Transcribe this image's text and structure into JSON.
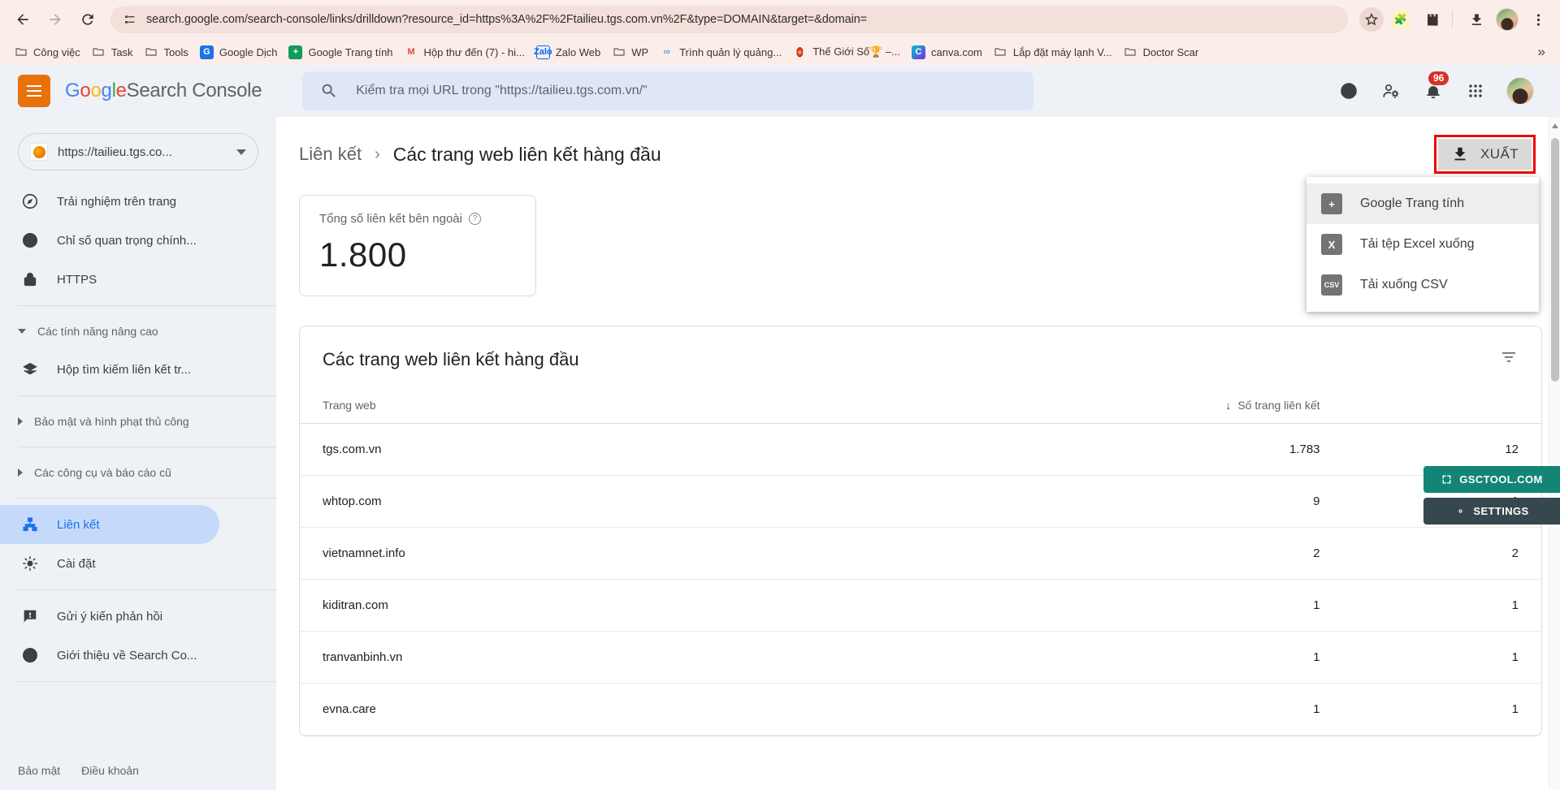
{
  "browser": {
    "url": "search.google.com/search-console/links/drilldown?resource_id=https%3A%2F%2Ftailieu.tgs.com.vn%2F&type=DOMAIN&target=&domain=",
    "back_icon": "back-arrow-icon",
    "forward_icon": "forward-arrow-icon",
    "reload_icon": "reload-icon",
    "bookmarks": [
      {
        "label": "Công việc",
        "icon": "folder-icon"
      },
      {
        "label": "Task",
        "icon": "folder-icon"
      },
      {
        "label": "Tools",
        "icon": "folder-icon"
      },
      {
        "label": "Google Dịch",
        "icon": "google-translate-icon"
      },
      {
        "label": "Google Trang tính",
        "icon": "google-sheets-icon"
      },
      {
        "label": "Hộp thư đến (7) - hi...",
        "icon": "gmail-icon"
      },
      {
        "label": "Zalo Web",
        "icon": "zalo-icon"
      },
      {
        "label": "WP",
        "icon": "folder-icon"
      },
      {
        "label": "Trình quản lý quảng...",
        "icon": "meta-icon"
      },
      {
        "label": "Thế Giới Số🏆 –...",
        "icon": "tgs-icon"
      },
      {
        "label": "canva.com",
        "icon": "canva-icon"
      },
      {
        "label": "Lắp đặt máy lạnh V...",
        "icon": "folder-icon"
      },
      {
        "label": "Doctor Scar",
        "icon": "folder-icon"
      }
    ],
    "bookmarks_overflow": "»"
  },
  "header": {
    "menu_icon": "hamburger-menu-icon",
    "logo_google": [
      "G",
      "o",
      "o",
      "g",
      "l",
      "e"
    ],
    "logo_rest": "Search Console",
    "search_placeholder": "Kiểm tra mọi URL trong \"https://tailieu.tgs.com.vn/\"",
    "notifications_count": "96"
  },
  "sidebar": {
    "property": "https://tailieu.tgs.co...",
    "items": [
      {
        "label": "Trải nghiệm trên trang",
        "icon": "page-experience-icon",
        "type": "item",
        "active": false
      },
      {
        "label": "Chỉ số quan trọng chính...",
        "icon": "core-vitals-icon",
        "type": "item",
        "active": false
      },
      {
        "label": "HTTPS",
        "icon": "lock-icon",
        "type": "item",
        "active": false
      },
      {
        "label": "Các tính năng nâng cao",
        "type": "group",
        "expanded": true
      },
      {
        "label": "Hộp tìm kiếm liên kết tr...",
        "icon": "sitelinks-searchbox-icon",
        "type": "item",
        "active": false
      },
      {
        "label": "Bảo mật và hình phạt thủ công",
        "type": "group",
        "expanded": false
      },
      {
        "label": "Các công cụ và báo cáo cũ",
        "type": "group",
        "expanded": false
      },
      {
        "label": "Liên kết",
        "icon": "links-icon",
        "type": "item",
        "active": true
      },
      {
        "label": "Cài đặt",
        "icon": "gear-icon",
        "type": "item",
        "active": false
      },
      {
        "label": "Gửi ý kiến phản hồi",
        "icon": "feedback-icon",
        "type": "item",
        "active": false
      },
      {
        "label": "Giới thiệu về Search Co...",
        "icon": "info-icon",
        "type": "item",
        "active": false
      }
    ],
    "footer": {
      "privacy": "Bảo mật",
      "terms": "Điều khoản"
    }
  },
  "main": {
    "breadcrumb_parent": "Liên kết",
    "breadcrumb_sep": "›",
    "breadcrumb_current": "Các trang web liên kết hàng đầu",
    "export_button": "XUẤT",
    "export_menu": [
      {
        "label": "Google Trang tính",
        "icon": "google-sheets-icon",
        "hovered": true
      },
      {
        "label": "Tải tệp Excel xuống",
        "icon": "excel-icon",
        "hovered": false
      },
      {
        "label": "Tải xuống CSV",
        "icon": "csv-icon",
        "hovered": false
      }
    ],
    "stat_card": {
      "label": "Tổng số liên kết bên ngoài",
      "value": "1.800",
      "help_icon": "help-circle-icon"
    },
    "table": {
      "title": "Các trang web liên kết hàng đầu",
      "filter_icon": "filter-icon",
      "columns": [
        "Trang web",
        "Số trang liên kết",
        ""
      ],
      "sort_arrow": "↓",
      "rows": [
        {
          "site": "tgs.com.vn",
          "linking_pages": "1.783",
          "target_pages": "12"
        },
        {
          "site": "whtop.com",
          "linking_pages": "9",
          "target_pages": "1"
        },
        {
          "site": "vietnamnet.info",
          "linking_pages": "2",
          "target_pages": "2"
        },
        {
          "site": "kiditran.com",
          "linking_pages": "1",
          "target_pages": "1"
        },
        {
          "site": "tranvanbinh.vn",
          "linking_pages": "1",
          "target_pages": "1"
        },
        {
          "site": "evna.care",
          "linking_pages": "1",
          "target_pages": "1"
        }
      ]
    },
    "badges": [
      {
        "label": "GSCTOOL.COM",
        "icon": "expand-icon",
        "color": "#128576"
      },
      {
        "label": "SETTINGS",
        "icon": "gear-icon",
        "color": "#37474f"
      }
    ]
  },
  "colors": {
    "accent_blue": "#1a73e8",
    "highlight_red": "#ef0000",
    "badge_teal": "#128576",
    "badge_dark": "#37474f",
    "notification_red": "#d93025",
    "brand_orange": "#e8710a"
  }
}
